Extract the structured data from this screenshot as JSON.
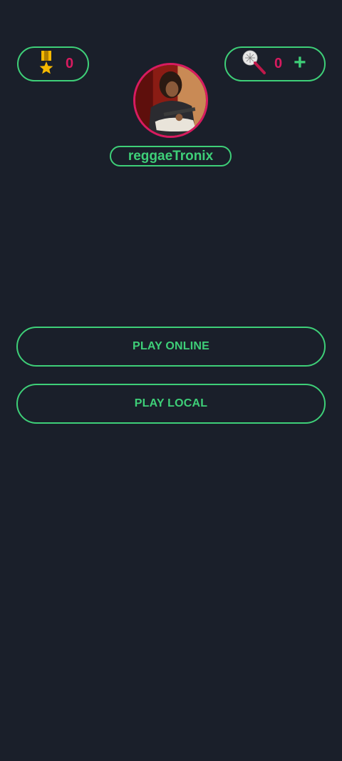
{
  "stats": {
    "medals": {
      "icon": "medal-icon",
      "count": "0"
    },
    "coins": {
      "icon": "microphone-icon",
      "count": "0",
      "add_label": "+"
    }
  },
  "profile": {
    "username": "reggaeTronix",
    "avatar": "avatar-photo"
  },
  "menu": {
    "play_online": "PLAY ONLINE",
    "play_local": "PLAY LOCAL"
  },
  "colors": {
    "background": "#1a1f2a",
    "accent": "#3ecf78",
    "count": "#d81b60",
    "medal": "#f5b800"
  }
}
